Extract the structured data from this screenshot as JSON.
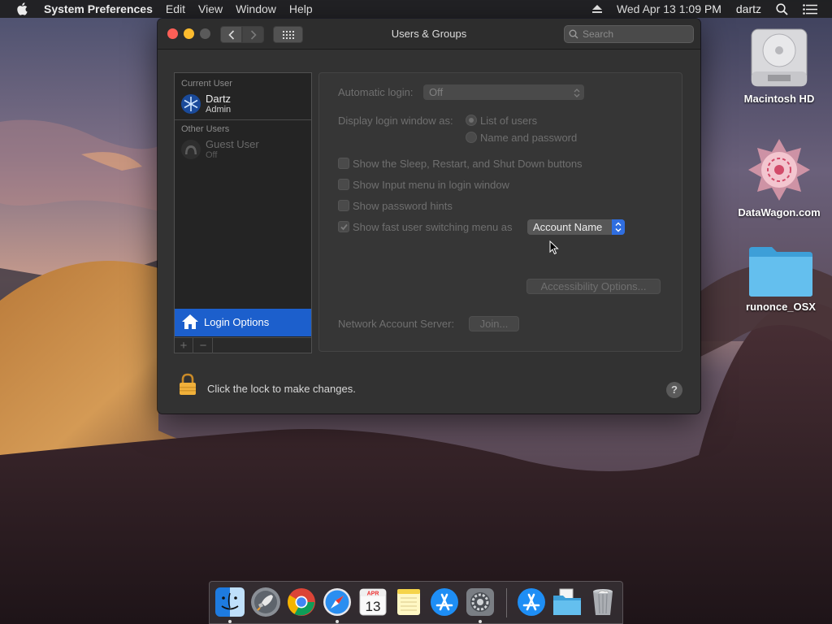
{
  "menubar": {
    "app_name": "System Preferences",
    "menus": [
      "Edit",
      "View",
      "Window",
      "Help"
    ],
    "datetime": "Wed Apr 13  1:09 PM",
    "user": "dartz"
  },
  "window": {
    "title": "Users & Groups",
    "search_placeholder": "Search"
  },
  "sidebar": {
    "current_user_label": "Current User",
    "current_user": {
      "name": "Dartz",
      "role": "Admin"
    },
    "other_users_label": "Other Users",
    "other_users": [
      {
        "name": "Guest User",
        "status": "Off"
      }
    ],
    "login_options_label": "Login Options",
    "add_label": "+",
    "remove_label": "−"
  },
  "login_panel": {
    "automatic_login_label": "Automatic login:",
    "automatic_login_value": "Off",
    "display_login_label": "Display login window as:",
    "display_options": [
      {
        "label": "List of users",
        "selected": true
      },
      {
        "label": "Name and password",
        "selected": false
      }
    ],
    "checkboxes": [
      {
        "label": "Show the Sleep, Restart, and Shut Down buttons",
        "checked": false
      },
      {
        "label": "Show Input menu in login window",
        "checked": false
      },
      {
        "label": "Show password hints",
        "checked": false
      },
      {
        "label": "Show fast user switching menu as",
        "checked": true
      }
    ],
    "switching_menu_value": "Account Name",
    "accessibility_button": "Accessibility Options...",
    "network_server_label": "Network Account Server:",
    "join_button": "Join..."
  },
  "footer": {
    "lock_text": "Click the lock to make changes.",
    "help_label": "?"
  },
  "desktop_icons": [
    {
      "label": "Macintosh HD",
      "icon": "hard-drive-icon"
    },
    {
      "label": "DataWagon.com",
      "icon": "datawagon-logo-icon"
    },
    {
      "label": "runonce_OSX",
      "icon": "folder-icon"
    }
  ],
  "dock": {
    "apps": [
      "Finder",
      "Launchpad",
      "Google Chrome",
      "Safari",
      "Calendar",
      "Notes",
      "App Store",
      "System Preferences",
      "App Store",
      "Downloads",
      "Trash"
    ],
    "calendar_month": "APR",
    "calendar_day": "13"
  },
  "colors": {
    "selection_blue": "#1c5fcc",
    "window_bg": "#323232",
    "close_red": "#fc5f57",
    "minimize_yellow": "#fdbc2e"
  }
}
